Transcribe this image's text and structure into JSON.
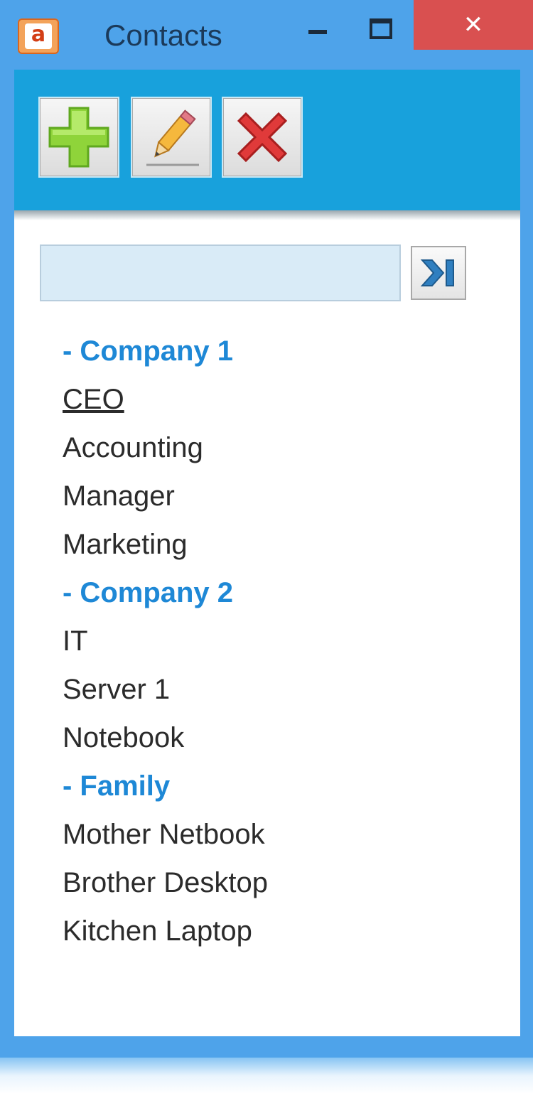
{
  "window": {
    "title": "Contacts",
    "app_icon_letter": "a",
    "close_glyph": "✕"
  },
  "toolbar": {
    "buttons": [
      {
        "name": "add",
        "icon": "green-plus-icon"
      },
      {
        "name": "edit",
        "icon": "pencil-icon"
      },
      {
        "name": "delete",
        "icon": "red-x-icon"
      }
    ]
  },
  "search": {
    "value": "",
    "placeholder": "",
    "go_icon": "jump-to-end-icon"
  },
  "tree": {
    "groups": [
      {
        "label": "- Company 1",
        "items": [
          "CEO",
          "Accounting",
          "Manager",
          "Marketing"
        ]
      },
      {
        "label": "- Company 2",
        "items": [
          "IT",
          "Server 1",
          "Notebook"
        ]
      },
      {
        "label": "- Family",
        "items": [
          "Mother Netbook",
          "Brother Desktop",
          "Kitchen Laptop"
        ]
      }
    ]
  },
  "colors": {
    "window_frame": "#4ea3ea",
    "toolbar": "#18a1dc",
    "group_text": "#1e88d6",
    "close_button": "#d95050"
  }
}
